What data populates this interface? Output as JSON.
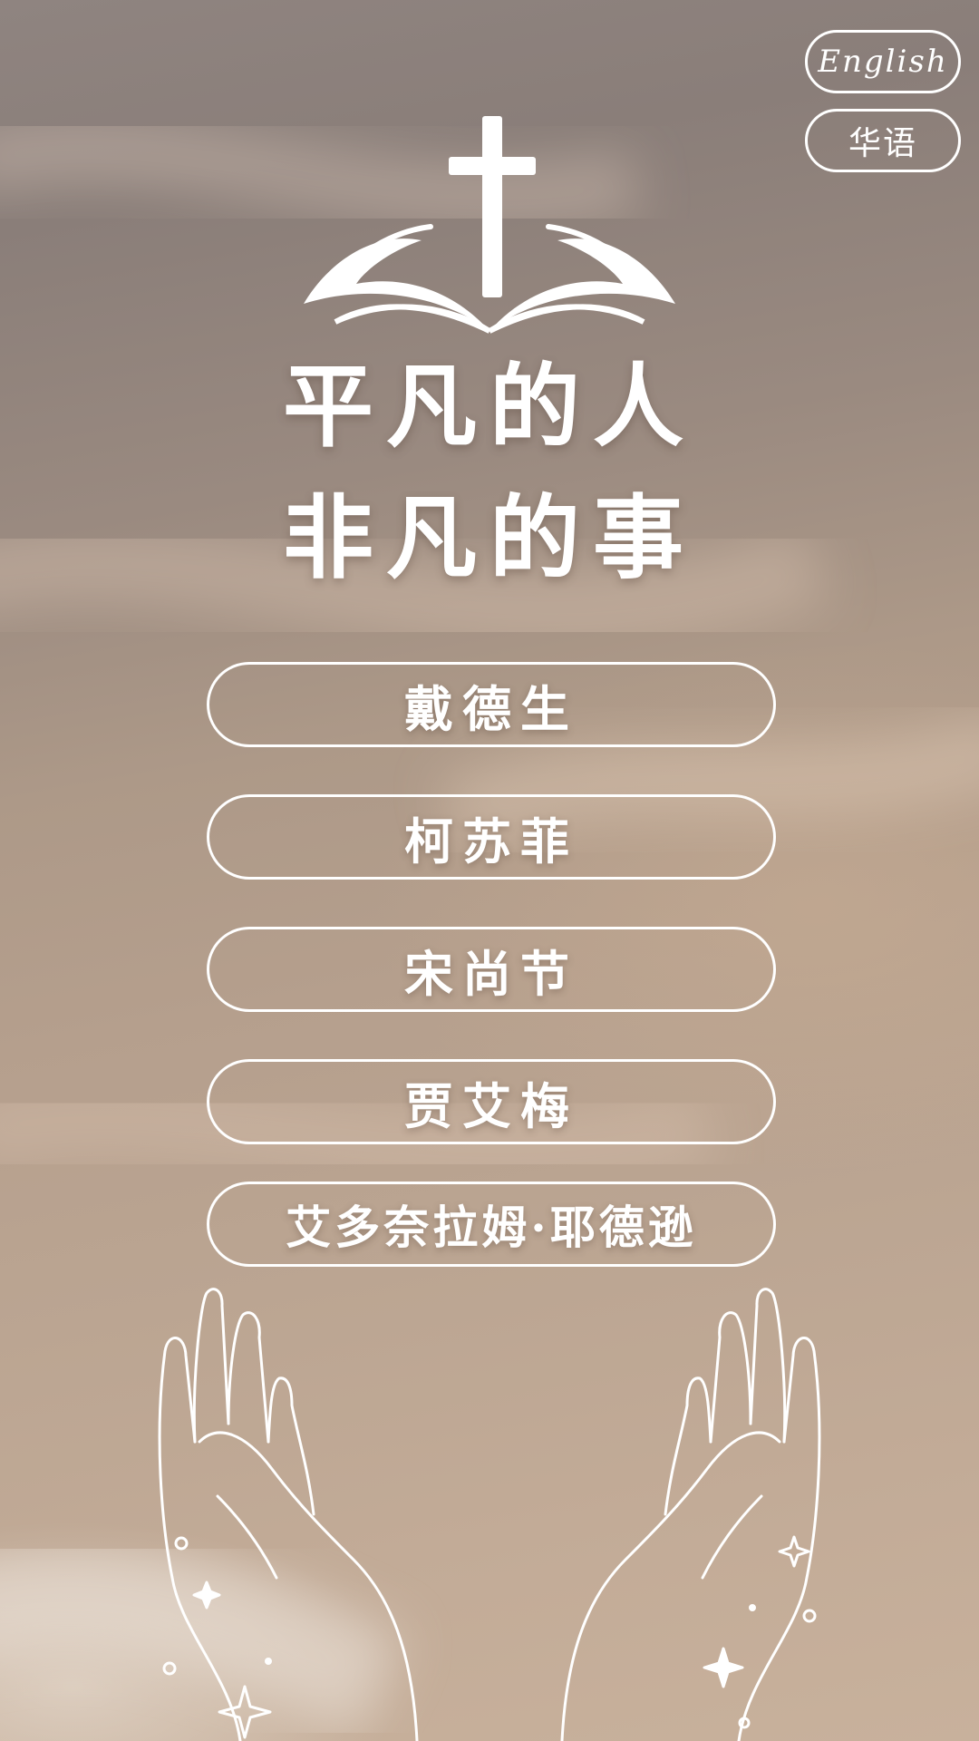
{
  "language_switch": {
    "english_label": "English",
    "chinese_label": "华语"
  },
  "logo": {
    "icon": "cross-bible-icon"
  },
  "title": {
    "line1": "平凡的人",
    "line2": "非凡的事"
  },
  "menu": {
    "items": [
      {
        "label": "戴德生"
      },
      {
        "label": "柯苏菲"
      },
      {
        "label": "宋尚节"
      },
      {
        "label": "贾艾梅"
      },
      {
        "label": "艾多奈拉姆·耶德逊"
      }
    ]
  },
  "decoration": {
    "icon": "praying-hands-icon",
    "sparkles": "sparkle-icon"
  },
  "colors": {
    "foreground": "#ffffff",
    "background_top": "#8a7e79",
    "background_bottom": "#c8b19c"
  }
}
